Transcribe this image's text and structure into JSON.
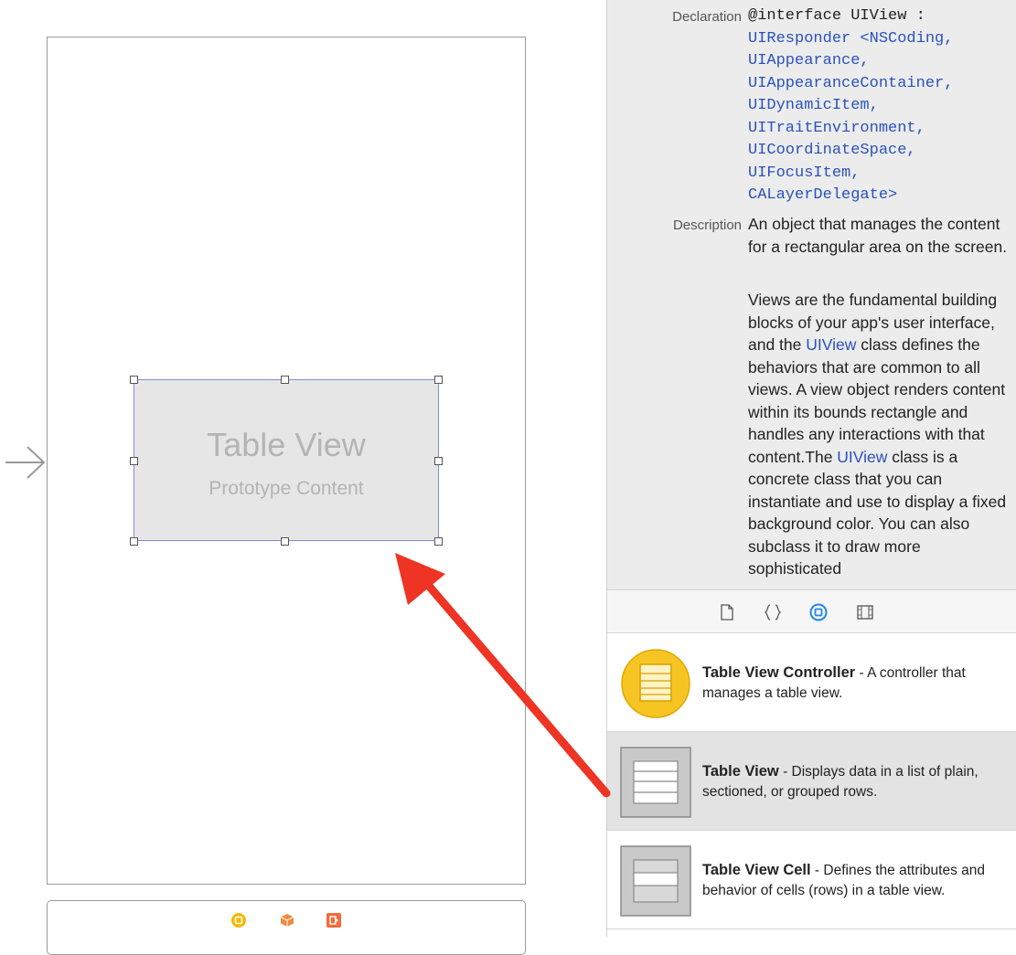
{
  "canvas": {
    "table_view_title": "Table View",
    "table_view_subtitle": "Prototype Content"
  },
  "quick_help": {
    "declaration_label": "Declaration",
    "declaration_lines": [
      "@interface UIView :",
      "UIResponder <NSCoding,",
      "UIAppearance,",
      "UIAppearanceContainer,",
      "UIDynamicItem,",
      "UITraitEnvironment,",
      "UICoordinateSpace,",
      "UIFocusItem,",
      "CALayerDelegate>"
    ],
    "description_label": "Description",
    "description_p1": "An object that manages the content for a rectangular area on the screen.",
    "description_p2_a": "Views are the fundamental building blocks of your app's user interface, and the ",
    "description_p2_link1": "UIView",
    "description_p2_b": " class defines the behaviors that are common to all views. A view object renders content within its bounds rectangle and handles any interactions with that content.The ",
    "description_p2_link2": "UIView",
    "description_p2_c": " class is a concrete class that you can instantiate and use to display a fixed background color. You can also subclass it to draw more sophisticated"
  },
  "library_tabs": [
    "file-template-icon",
    "code-snippet-icon",
    "object-library-icon",
    "media-library-icon"
  ],
  "library": {
    "items": [
      {
        "name": "Table View Controller",
        "desc": " - A controller that manages a table view."
      },
      {
        "name": "Table View",
        "desc": " - Displays data in a list of plain, sectioned, or grouped rows."
      },
      {
        "name": "Table View Cell",
        "desc": " - Defines the attributes and behavior of cells (rows) in a table view."
      }
    ]
  },
  "colors": {
    "accent": "#1e88e5",
    "link": "#2a52be",
    "selection_border": "#7f8cde",
    "annotation_arrow": "#ee3424"
  }
}
